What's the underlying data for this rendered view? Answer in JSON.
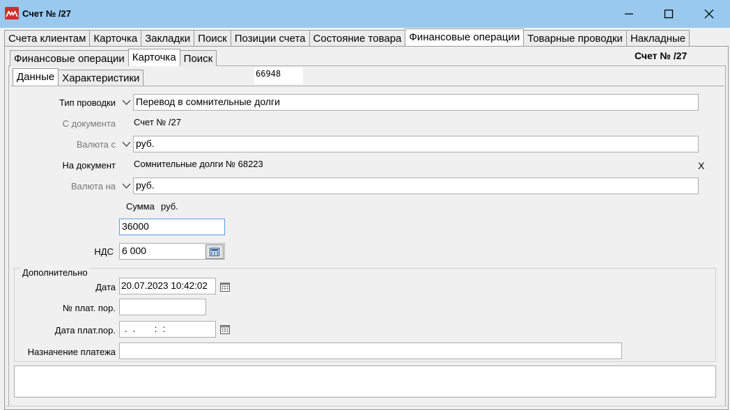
{
  "window": {
    "title": "Счет №  /27",
    "minimize_icon": "minimize-icon",
    "maximize_icon": "maximize-icon",
    "close_icon": "close-icon"
  },
  "outer_tabs": [
    "Счета клиентам",
    "Карточка",
    "Закладки",
    "Поиск",
    "Позиции счета",
    "Состояние товара",
    "Финансовые операции",
    "Товарные проводки",
    "Накладные"
  ],
  "outer_active": 6,
  "mid_tabs": [
    "Финансовые операции",
    "Карточка",
    "Поиск"
  ],
  "mid_active": 1,
  "inner_tabs": [
    "Данные",
    "Характеристики"
  ],
  "inner_active": 0,
  "header": {
    "doc_title": "Счет №  /27",
    "code": "66948"
  },
  "form": {
    "type_label": "Тип проводки",
    "type_value": "Перевод в сомнительные долги",
    "from_doc_label": "С документа",
    "from_doc_value": "Счет №  /27",
    "currency_from_label": "Валюта с",
    "currency_from_value": "руб.",
    "to_doc_label": "На документ",
    "to_doc_value": "Сомнительные долги № 68223",
    "to_doc_clear": "X",
    "currency_to_label": "Валюта на",
    "currency_to_value": "руб.",
    "sum_label": "Сумма",
    "sum_currency": "руб.",
    "sum_value": "36000",
    "vat_label": "НДС",
    "vat_value": "6 000"
  },
  "extra": {
    "group_title": "Дополнительно",
    "date_label": "Дата",
    "date_value": "20.07.2023 10:42:02",
    "pay_no_label": "№ плат. пор.",
    "pay_no_value": "",
    "pay_date_label": "Дата плат.пор.",
    "pay_date_value": " .  .       :  :",
    "purpose_label": "Назначение платежа",
    "purpose_value": ""
  },
  "colors": {
    "titlebar": "#99c9ef",
    "logo": "#d42c2c",
    "focus_border": "#569de5"
  }
}
